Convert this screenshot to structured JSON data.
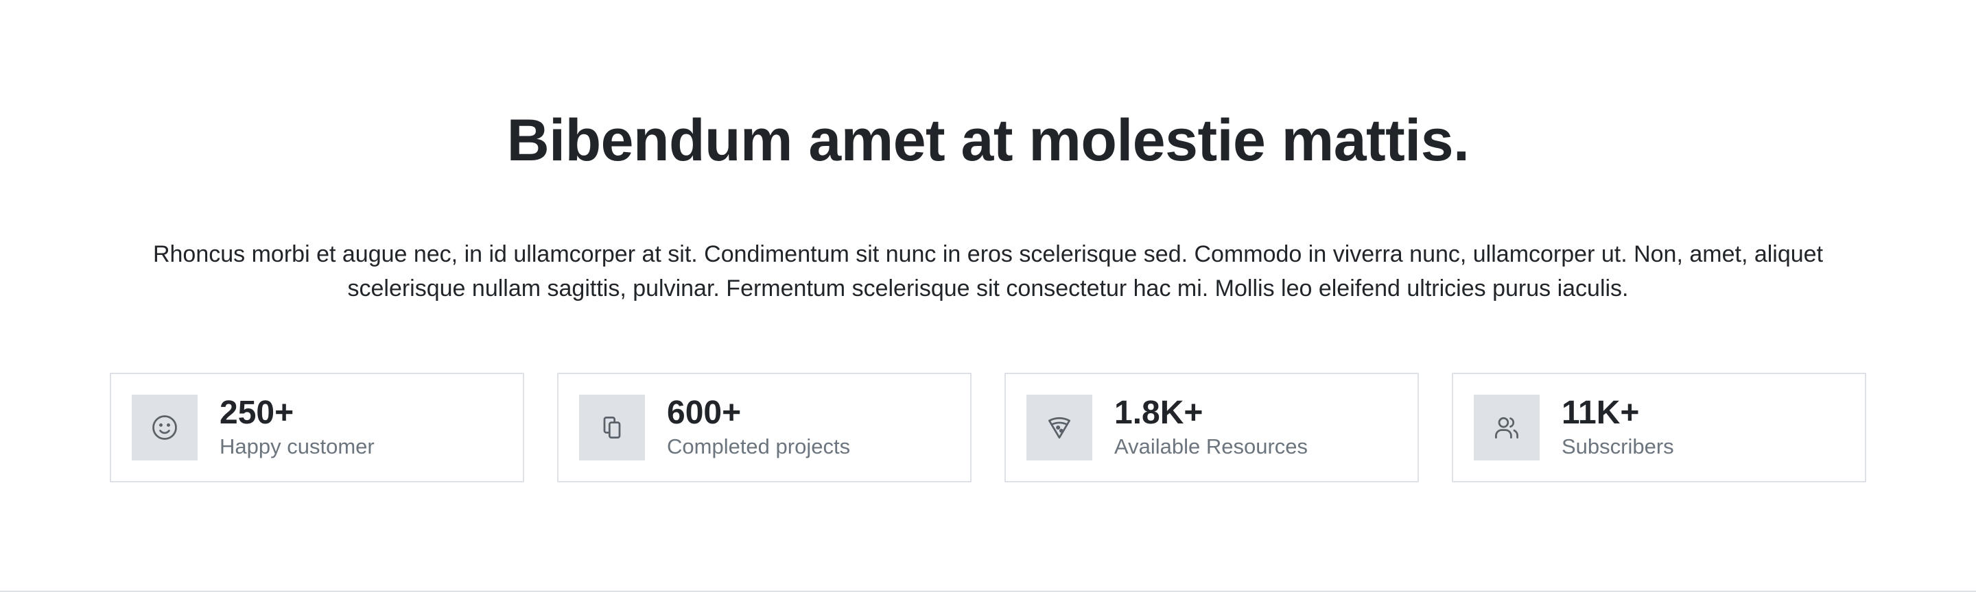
{
  "heading": "Bibendum amet at molestie mattis.",
  "description": "Rhoncus morbi et augue nec, in id ullamcorper at sit. Condimentum sit nunc in eros scelerisque sed. Commodo in viverra nunc, ullamcorper ut. Non, amet, aliquet scelerisque nullam sagittis, pulvinar. Fermentum scelerisque sit consectetur hac mi. Mollis leo eleifend ultricies purus iaculis.",
  "stats": [
    {
      "icon": "smiley-icon",
      "value": "250+",
      "label": "Happy customer"
    },
    {
      "icon": "copy-files-icon",
      "value": "600+",
      "label": "Completed projects"
    },
    {
      "icon": "pizza-icon",
      "value": "1.8K+",
      "label": "Available Resources"
    },
    {
      "icon": "users-icon",
      "value": "11K+",
      "label": "Subscribers"
    }
  ],
  "colors": {
    "heading": "#212529",
    "muted": "#6c757d",
    "border": "#dee2e6",
    "icon_bg": "#dee2e6",
    "icon_stroke": "#5a6169"
  }
}
